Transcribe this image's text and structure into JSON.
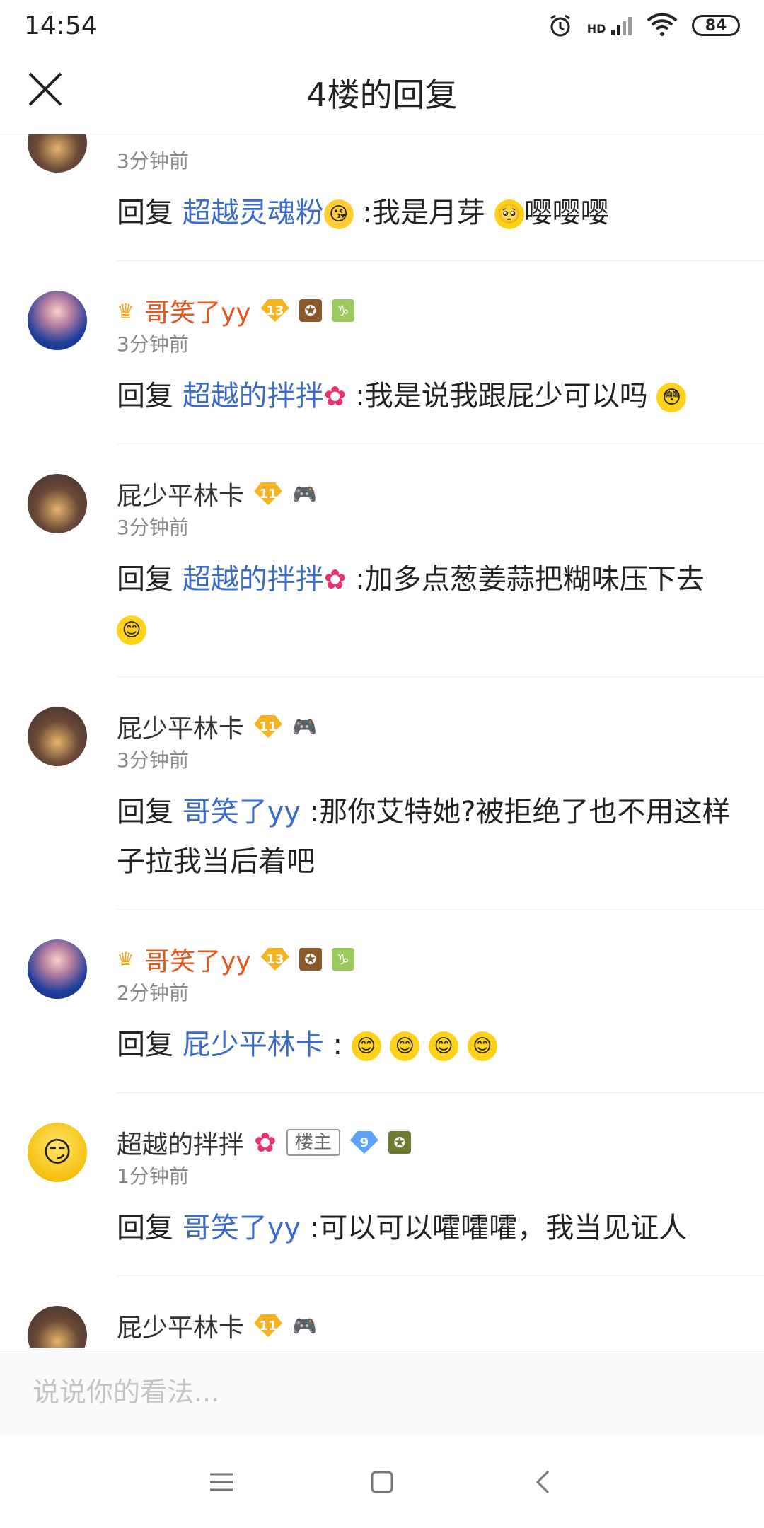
{
  "status": {
    "time": "14:54",
    "hd": "HD",
    "battery": "84"
  },
  "header": {
    "title": "4楼的回复"
  },
  "comments": [
    {
      "name": "",
      "time": "3分钟前",
      "prefix": "回复",
      "target": "超越灵魂粉",
      "text": ":我是月芽",
      "tail": "嘤嘤嘤"
    },
    {
      "name": "哥笑了yy",
      "level": "13",
      "time": "3分钟前",
      "prefix": "回复",
      "target": "超越的拌拌",
      "text": ":我是说我跟屁少可以吗"
    },
    {
      "name": "屁少平林卡",
      "level": "11",
      "time": "3分钟前",
      "prefix": "回复",
      "target": "超越的拌拌",
      "text": ":加多点葱姜蒜把糊味压下去"
    },
    {
      "name": "屁少平林卡",
      "level": "11",
      "time": "3分钟前",
      "prefix": "回复",
      "target": "哥笑了yy",
      "text": ":那你艾特她?被拒绝了也不用这样子拉我当后着吧"
    },
    {
      "name": "哥笑了yy",
      "level": "13",
      "time": "2分钟前",
      "prefix": "回复",
      "target": "屁少平林卡",
      "text": ":"
    },
    {
      "name": "超越的拌拌",
      "owner": "楼主",
      "level": "9",
      "time": "1分钟前",
      "prefix": "回复",
      "target": "哥笑了yy",
      "text": ":可以可以嚯嚯嚯，我当见证人"
    },
    {
      "name": "屁少平林卡",
      "level": "11"
    }
  ],
  "input": {
    "placeholder": "说说你的看法..."
  }
}
